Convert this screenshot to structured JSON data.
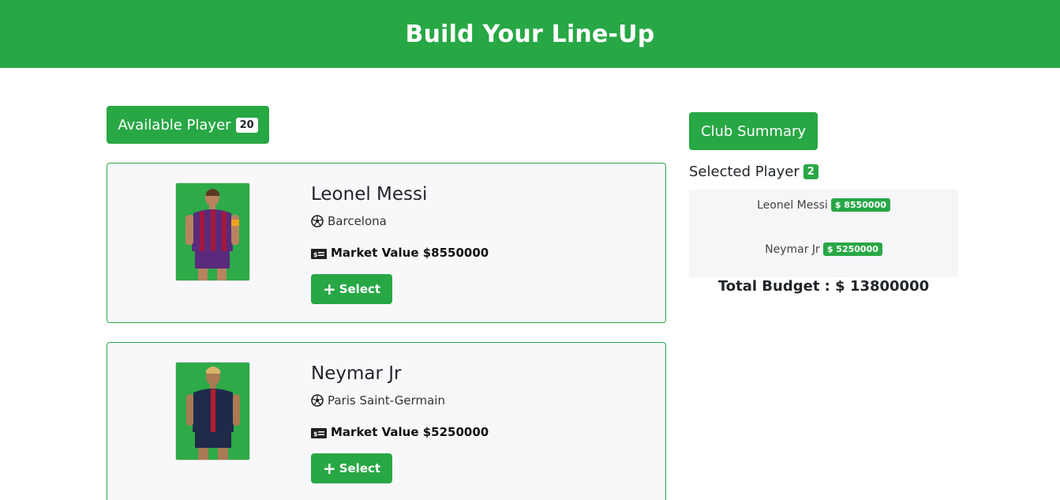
{
  "header": {
    "title": "Build Your Line-Up"
  },
  "available": {
    "label": "Available Player",
    "count": "20"
  },
  "players": [
    {
      "name": "Leonel Messi",
      "club": "Barcelona",
      "market_value": "Market Value $8550000",
      "select_label": "Select",
      "kit_color": "#5a2a7c"
    },
    {
      "name": "Neymar Jr",
      "club": "Paris Saint-Germain",
      "market_value": "Market Value $5250000",
      "select_label": "Select",
      "kit_color": "#1f2a4a"
    }
  ],
  "summary": {
    "button_label": "Club Summary",
    "selected_label": "Selected Player",
    "selected_count": "2",
    "items": [
      {
        "name": "Leonel Messi",
        "price": "$ 8550000"
      },
      {
        "name": "Neymar Jr",
        "price": "$ 5250000"
      }
    ],
    "total": "Total Budget : $ 13800000"
  },
  "icons": {
    "club": "soccer-ball-icon",
    "value": "money-bill-icon",
    "select": "plus-icon"
  },
  "colors": {
    "accent": "#28a745",
    "card_bg": "#f8f8fa"
  }
}
